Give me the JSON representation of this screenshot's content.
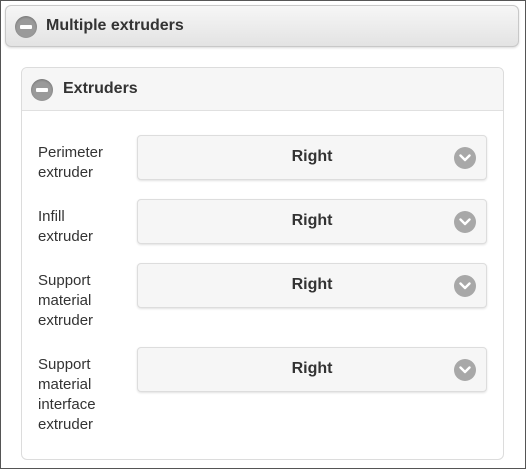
{
  "outer_panel": {
    "title": "Multiple extruders",
    "icon": "collapse-minus-icon"
  },
  "inner_panel": {
    "title": "Extruders",
    "icon": "collapse-minus-icon"
  },
  "rows": [
    {
      "label": "Perimeter extruder",
      "value": "Right"
    },
    {
      "label": "Infill extruder",
      "value": "Right"
    },
    {
      "label": "Support material extruder",
      "value": "Right"
    },
    {
      "label": "Support material interface extruder",
      "value": "Right"
    }
  ],
  "colors": {
    "header_gradient_top": "#f6f6f6",
    "header_gradient_bottom": "#e3e3e3",
    "icon_gray": "#9a9a9a",
    "text": "#333333"
  }
}
